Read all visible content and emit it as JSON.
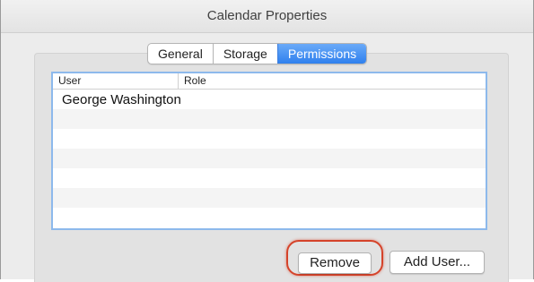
{
  "window": {
    "title": "Calendar Properties"
  },
  "tabs": [
    {
      "label": "General",
      "active": false
    },
    {
      "label": "Storage",
      "active": false
    },
    {
      "label": "Permissions",
      "active": true
    }
  ],
  "table": {
    "columns": [
      "User",
      "Role"
    ],
    "rows": [
      {
        "user": "George Washington",
        "role": ""
      },
      {
        "user": "",
        "role": ""
      },
      {
        "user": "",
        "role": ""
      },
      {
        "user": "",
        "role": ""
      },
      {
        "user": "",
        "role": ""
      },
      {
        "user": "",
        "role": ""
      },
      {
        "user": "",
        "role": ""
      }
    ]
  },
  "buttons": {
    "remove_label": "Remove",
    "add_user_label": "Add User..."
  },
  "colors": {
    "accent": "#2f80ee",
    "highlight": "#d5432a",
    "table_border": "#8db9ec"
  }
}
